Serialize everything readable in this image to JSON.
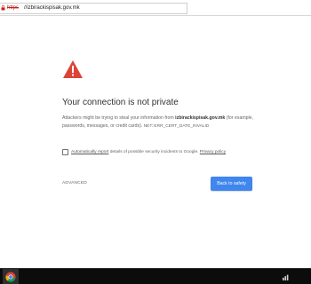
{
  "addressbar": {
    "scheme": "https",
    "host": "//izbirackispisak.gov.mk"
  },
  "interstitial": {
    "title": "Your connection is not private",
    "desc_prefix": "Attackers might be trying to steal your information from ",
    "domain": "izbirackispisak.gov.mk",
    "desc_suffix": " (for example, passwords, messages, or credit cards).",
    "error_code": "NET::ERR_CERT_DATE_INVALID",
    "checkbox_checked": false,
    "checkbox_link1": "Automatically report",
    "checkbox_middle": " details of possible security incidents to Google. ",
    "checkbox_link2": "Privacy policy",
    "advanced_label": "ADVANCED",
    "back_label": "Back to safety",
    "accent_color": "#3f86ee",
    "warning_color": "#db4437"
  },
  "taskbar": {
    "pinned": [
      "chrome-icon"
    ],
    "tray": [
      "network-icon"
    ]
  }
}
